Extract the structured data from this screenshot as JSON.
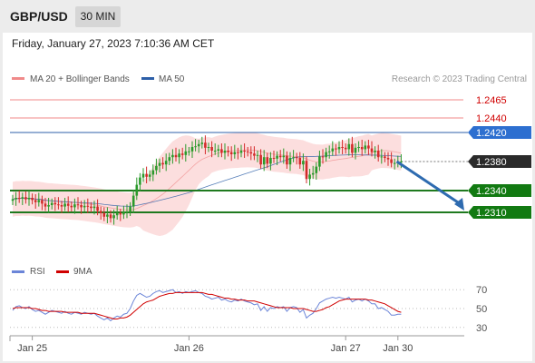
{
  "header": {
    "symbol": "GBP/USD",
    "timeframe": "30 MIN"
  },
  "datetime": "Friday, January 27, 2023 7:10:36 AM CET",
  "colors": {
    "bollinger": "#f08a8a",
    "ma50": "#2d5fa8",
    "bull": "#2b9a2b",
    "bear": "#d32a2a",
    "support": "#1f7a1f",
    "rsi": "#6b85d8",
    "rsi_ma": "#d00000",
    "arrow": "#2e6bb0"
  },
  "chart_data": [
    {
      "type": "candlestick",
      "legend": [
        {
          "name": "MA 20 + Bollinger Bands",
          "color": "#f08a8a"
        },
        {
          "name": "MA 50",
          "color": "#2d5fa8"
        }
      ],
      "watermark": "Research © 2023 Trading Central",
      "y_range": [
        1.2255,
        1.2485
      ],
      "x_ticks": [
        {
          "label": "Jan 25",
          "index": 6
        },
        {
          "label": "Jan 26",
          "index": 54
        },
        {
          "label": "Jan 27",
          "index": 102
        },
        {
          "label": "Jan 30",
          "index": 118
        }
      ],
      "levels": [
        {
          "value": 1.2465,
          "label": "1.2465",
          "kind": "resistance"
        },
        {
          "value": 1.244,
          "label": "1.2440",
          "kind": "resistance"
        },
        {
          "value": 1.242,
          "label": "1.2420",
          "kind": "ma50"
        },
        {
          "value": 1.238,
          "label": "1.2380",
          "kind": "last"
        },
        {
          "value": 1.234,
          "label": "1.2340",
          "kind": "support"
        },
        {
          "value": 1.231,
          "label": "1.2310",
          "kind": "support"
        }
      ],
      "forecast_arrow": {
        "from": {
          "index": 121,
          "value": 1.238
        },
        "to": {
          "index": 131,
          "value": 1.231
        }
      },
      "closes": [
        1.2328,
        1.233,
        1.2329,
        1.2331,
        1.2328,
        1.233,
        1.2327,
        1.2324,
        1.2327,
        1.2322,
        1.2318,
        1.232,
        1.2323,
        1.2321,
        1.232,
        1.2318,
        1.2322,
        1.2319,
        1.2317,
        1.2321,
        1.232,
        1.2317,
        1.2319,
        1.2318,
        1.2316,
        1.2318,
        1.2312,
        1.2309,
        1.2304,
        1.2307,
        1.2302,
        1.2306,
        1.2309,
        1.2307,
        1.2311,
        1.2311,
        1.2318,
        1.2333,
        1.2348,
        1.2358,
        1.2363,
        1.2359,
        1.2362,
        1.2368,
        1.2374,
        1.2378,
        1.2376,
        1.2381,
        1.2386,
        1.2389,
        1.2386,
        1.2391,
        1.2389,
        1.2394,
        1.2394,
        1.24,
        1.2401,
        1.2404,
        1.2406,
        1.2399,
        1.24,
        1.2395,
        1.2395,
        1.2397,
        1.2392,
        1.2395,
        1.2393,
        1.239,
        1.2393,
        1.2392,
        1.2395,
        1.2394,
        1.2393,
        1.2391,
        1.2388,
        1.2389,
        1.2376,
        1.2386,
        1.2377,
        1.2385,
        1.2384,
        1.2388,
        1.2386,
        1.2388,
        1.2376,
        1.2385,
        1.2386,
        1.2385,
        1.2376,
        1.2381,
        1.2356,
        1.2362,
        1.2364,
        1.2373,
        1.2387,
        1.2386,
        1.2393,
        1.2394,
        1.2398,
        1.2397,
        1.24,
        1.2399,
        1.2397,
        1.2404,
        1.2392,
        1.2399,
        1.24,
        1.2397,
        1.2402,
        1.2398,
        1.2393,
        1.2395,
        1.2386,
        1.2387,
        1.2385,
        1.2383,
        1.2378,
        1.2378,
        1.238,
        1.238
      ]
    },
    {
      "type": "line",
      "legend": [
        {
          "name": "RSI",
          "color": "#6b85d8"
        },
        {
          "name": "9MA",
          "color": "#d00000"
        }
      ],
      "y_range": [
        25,
        75
      ],
      "y_ticks": [
        "70",
        "50",
        "30"
      ],
      "rsi": [
        48,
        52,
        53,
        51,
        50,
        52,
        49,
        47,
        48,
        46,
        44,
        46,
        48,
        47,
        46,
        45,
        47,
        45,
        44,
        46,
        45,
        44,
        46,
        45,
        44,
        45,
        42,
        40,
        38,
        40,
        37,
        40,
        42,
        41,
        44,
        45,
        50,
        58,
        64,
        66,
        64,
        62,
        63,
        66,
        68,
        69,
        67,
        68,
        69,
        70,
        67,
        68,
        66,
        68,
        67,
        68,
        69,
        67,
        66,
        63,
        62,
        60,
        61,
        62,
        59,
        60,
        58,
        57,
        59,
        58,
        60,
        58,
        57,
        56,
        54,
        55,
        48,
        52,
        47,
        51,
        50,
        52,
        51,
        52,
        47,
        51,
        52,
        51,
        46,
        49,
        40,
        43,
        45,
        50,
        56,
        58,
        60,
        61,
        62,
        61,
        62,
        61,
        60,
        62,
        57,
        59,
        60,
        58,
        60,
        58,
        55,
        55,
        50,
        51,
        49,
        47,
        43,
        43,
        44,
        44
      ],
      "rsi_ma": [
        50,
        51,
        51,
        51,
        51,
        51,
        50,
        50,
        49,
        48,
        48,
        47,
        47,
        47,
        47,
        47,
        46,
        46,
        46,
        46,
        46,
        45,
        45,
        45,
        45,
        45,
        44,
        43,
        42,
        41,
        40,
        39,
        39,
        40,
        40,
        41,
        43,
        46,
        49,
        52,
        55,
        57,
        58,
        59,
        61,
        63,
        64,
        65,
        66,
        66,
        67,
        67,
        67,
        67,
        67,
        67,
        67,
        67,
        67,
        66,
        65,
        65,
        64,
        63,
        62,
        61,
        61,
        60,
        60,
        59,
        59,
        59,
        58,
        58,
        58,
        57,
        56,
        55,
        54,
        53,
        52,
        51,
        51,
        51,
        51,
        51,
        50,
        50,
        50,
        50,
        49,
        48,
        47,
        47,
        48,
        49,
        51,
        52,
        54,
        56,
        58,
        59,
        60,
        60,
        60,
        60,
        60,
        60,
        60,
        59,
        59,
        58,
        57,
        56,
        55,
        53,
        51,
        49,
        47,
        46
      ]
    }
  ]
}
